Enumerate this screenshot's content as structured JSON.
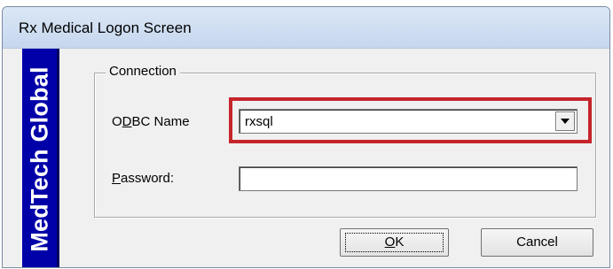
{
  "window": {
    "title": "Rx Medical Logon Screen"
  },
  "brand": {
    "text": "MedTech Global",
    "bg_color": "#0000a8"
  },
  "connection_group": {
    "legend": "Connection",
    "odbc": {
      "label_before": "O",
      "label_accel": "D",
      "label_after": "BC Name",
      "selected_value": "rxsql",
      "highlight_color": "#c5252b"
    },
    "password": {
      "label_accel": "P",
      "label_after": "assword:",
      "value": ""
    }
  },
  "buttons": {
    "ok_accel": "O",
    "ok_after": "K",
    "cancel": "Cancel"
  }
}
